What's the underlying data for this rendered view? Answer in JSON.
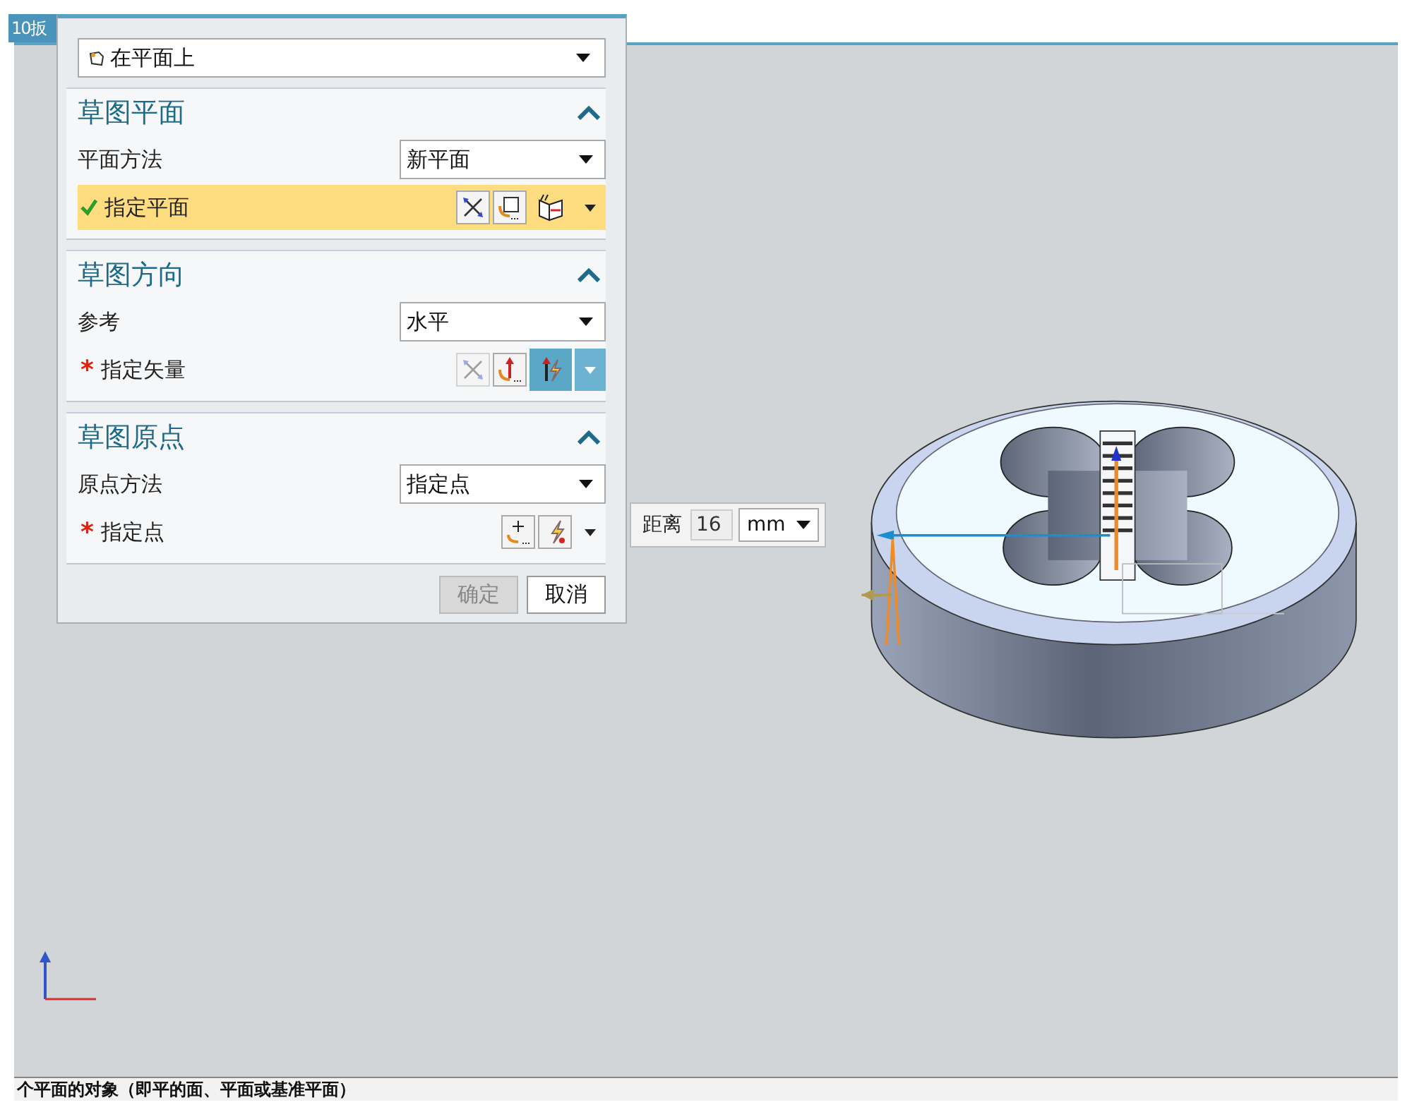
{
  "tab": {
    "label": "10扳"
  },
  "dialog": {
    "type_select": {
      "value": "在平面上"
    },
    "sections": [
      {
        "title": "草图平面",
        "expanded": true,
        "rows": [
          {
            "kind": "select",
            "label": "平面方法",
            "value": "新平面"
          },
          {
            "kind": "selector",
            "label": "指定平面",
            "checked": true,
            "active": true,
            "tools": [
              {
                "kind": "cross",
                "selected": false,
                "disabled": false
              },
              {
                "kind": "pick",
                "selected": false,
                "disabled": false
              },
              {
                "kind": "plane",
                "selected": true,
                "disabled": false
              }
            ]
          }
        ]
      },
      {
        "title": "草图方向",
        "expanded": true,
        "rows": [
          {
            "kind": "select",
            "label": "参考",
            "value": "水平"
          },
          {
            "kind": "selector",
            "label": "指定矢量",
            "checked": false,
            "required_mark": "*",
            "active": false,
            "tools": [
              {
                "kind": "cross",
                "selected": false,
                "disabled": true
              },
              {
                "kind": "vector",
                "selected": false,
                "disabled": false
              },
              {
                "kind": "inferred-vector",
                "selected": true,
                "disabled": false
              }
            ]
          }
        ]
      },
      {
        "title": "草图原点",
        "expanded": true,
        "rows": [
          {
            "kind": "select",
            "label": "原点方法",
            "value": "指定点"
          },
          {
            "kind": "selector",
            "label": "指定点",
            "checked": false,
            "required_mark": "*",
            "active": false,
            "tools": [
              {
                "kind": "point",
                "selected": false,
                "disabled": false
              },
              {
                "kind": "inferred-point",
                "selected": false,
                "disabled": false
              }
            ]
          }
        ]
      }
    ],
    "buttons": [
      {
        "label": "确定",
        "disabled": true
      },
      {
        "label": "取消",
        "disabled": false
      }
    ]
  },
  "distance_popup": {
    "label": "距离",
    "value": "16",
    "unit": "mm"
  },
  "status_bar": {
    "text": "个平面的对象（即平的面、平面或基准平面）"
  }
}
